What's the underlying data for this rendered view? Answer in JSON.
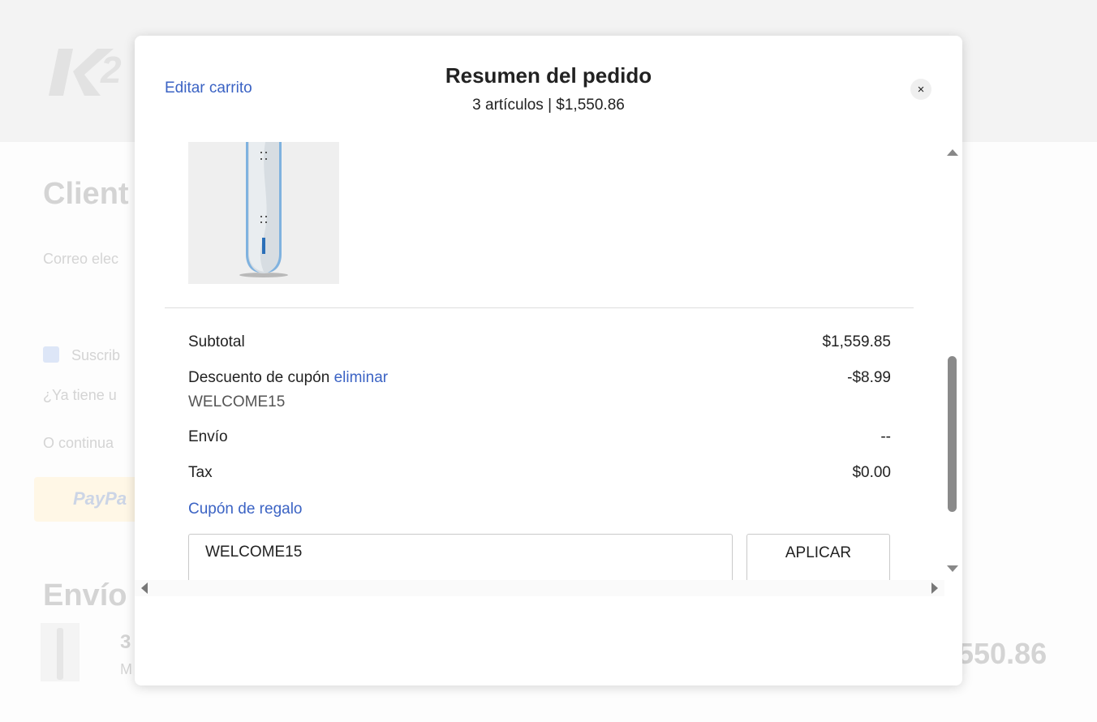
{
  "background": {
    "section_title_1": "Client",
    "email_label": "Correo elec",
    "subscribe_label": "Suscrib",
    "have_account": "¿Ya tiene u",
    "continue_with": "O continua",
    "paypal_label": "PayPa",
    "section_title_2": "Envío",
    "summary_count": "3",
    "summary_sub": "M",
    "summary_total": "550.86"
  },
  "modal": {
    "edit_cart_label": "Editar carrito",
    "title": "Resumen del pedido",
    "subtitle": "3 artículos | $1,550.86",
    "close_label": "×"
  },
  "summary": {
    "subtotal_label": "Subtotal",
    "subtotal_value": "$1,559.85",
    "discount_label": "Descuento de cupón",
    "discount_remove_label": "eliminar",
    "discount_value": "-$8.99",
    "discount_code": "WELCOME15",
    "shipping_label": "Envío",
    "shipping_value": "--",
    "tax_label": "Tax",
    "tax_value": "$0.00",
    "gift_coupon_label": "Cupón de regalo"
  },
  "coupon_form": {
    "input_value": "WELCOME15",
    "apply_label": "APLICAR"
  },
  "colors": {
    "link": "#3b63c4",
    "snowboard_accent": "#4a90d9"
  }
}
